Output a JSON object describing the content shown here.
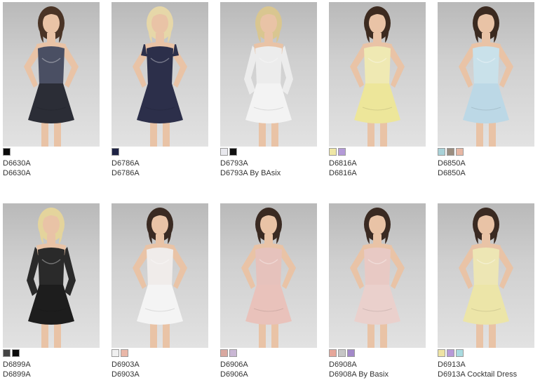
{
  "products": [
    {
      "code": "D6630A",
      "name": "D6630A",
      "dress_color": "#2b2d36",
      "bodice_color": "#4a4f63",
      "sleeves": "none",
      "hair": "#4a3426",
      "swatches": [
        {
          "color": "#0b0b0b"
        }
      ]
    },
    {
      "code": "D6786A",
      "name": "D6786A",
      "dress_color": "#2c2f4a",
      "bodice_color": "#2c2f4a",
      "sleeves": "cap",
      "hair": "#e6d7a8",
      "swatches": [
        {
          "color": "#1e2244"
        }
      ]
    },
    {
      "code": "D6793A",
      "name": "D6793A By BAsix",
      "dress_color": "#f3f3f3",
      "bodice_color": "#ececec",
      "sleeves": "long",
      "hair": "#d9c690",
      "swatches": [
        {
          "color": "#e9e9ee"
        },
        {
          "color": "#111111"
        }
      ]
    },
    {
      "code": "D6816A",
      "name": "D6816A",
      "dress_color": "#ede69a",
      "bodice_color": "#efe9b3",
      "sleeves": "none",
      "hair": "#3d2b20",
      "swatches": [
        {
          "color": "#efe7a6"
        },
        {
          "color": "#b49ad8"
        }
      ]
    },
    {
      "code": "D6850A",
      "name": "D6850A",
      "dress_color": "#bcd8e6",
      "bodice_color": "#c9e1ea",
      "sleeves": "none",
      "hair": "#3b2a20",
      "swatches": [
        {
          "color": "#a9d2d8"
        },
        {
          "color": "#9a8d80"
        },
        {
          "color": "#e7b7a4"
        }
      ]
    },
    {
      "code": "D6899A",
      "name": "D6899A",
      "dress_color": "#1d1d1d",
      "bodice_color": "#2a2a2a",
      "sleeves": "long",
      "hair": "#e4d49c",
      "swatches": [
        {
          "color": "#444444"
        },
        {
          "color": "#0b0b0b"
        }
      ]
    },
    {
      "code": "D6903A",
      "name": "D6903A",
      "dress_color": "#f4f4f4",
      "bodice_color": "#f0ecea",
      "sleeves": "none",
      "hair": "#3a2a22",
      "swatches": [
        {
          "color": "#f0f0f0"
        },
        {
          "color": "#e9b7a8"
        }
      ]
    },
    {
      "code": "D6906A",
      "name": "D6906A",
      "dress_color": "#e9c2bb",
      "bodice_color": "#e6c2bc",
      "sleeves": "none",
      "hair": "#3a2a22",
      "swatches": [
        {
          "color": "#d9a9a0"
        },
        {
          "color": "#c9b7d4"
        }
      ]
    },
    {
      "code": "D6908A",
      "name": "D6908A By Basix",
      "dress_color": "#ead0cc",
      "bodice_color": "#e8c9c4",
      "sleeves": "none",
      "hair": "#3a2a22",
      "swatches": [
        {
          "color": "#e6a79a"
        },
        {
          "color": "#c6c6c6"
        },
        {
          "color": "#a389c9"
        }
      ]
    },
    {
      "code": "D6913A",
      "name": "D6913A Cocktail Dress",
      "dress_color": "#ece5a8",
      "bodice_color": "#ede6b4",
      "sleeves": "none",
      "hair": "#3a2a22",
      "swatches": [
        {
          "color": "#eee3a4"
        },
        {
          "color": "#b79ad8"
        },
        {
          "color": "#a9dbe0"
        }
      ]
    }
  ]
}
